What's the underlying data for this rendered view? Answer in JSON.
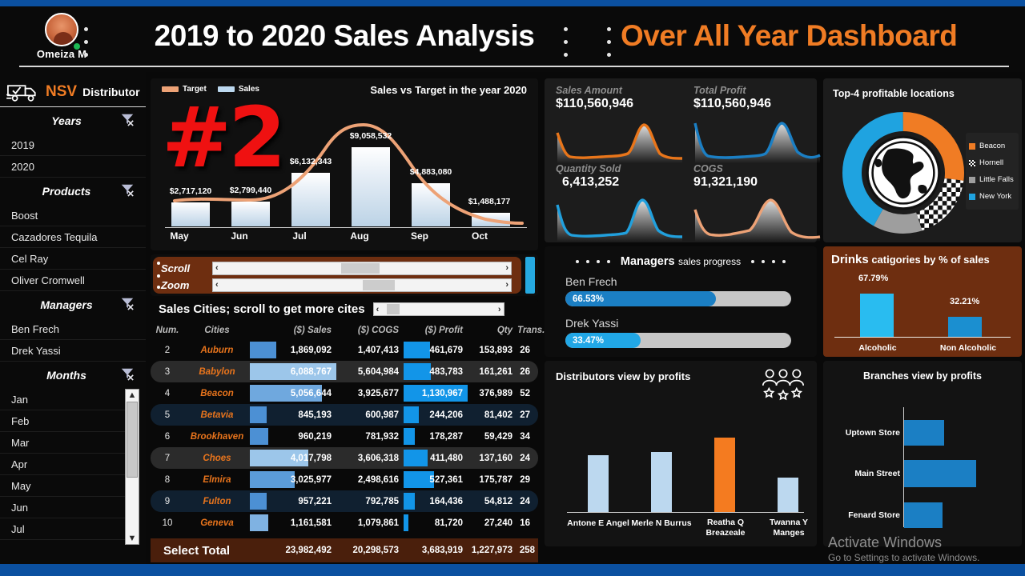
{
  "header": {
    "user_name": "Omeiza M",
    "title": "2019 to 2020 Sales Analysis",
    "subtitle": "Over All Year Dashboard"
  },
  "sidebar": {
    "brand_primary": "NSV",
    "brand_secondary": "Distributor",
    "sections": [
      {
        "label": "Years",
        "items": [
          "2019",
          "2020"
        ]
      },
      {
        "label": "Products",
        "items": [
          "Boost",
          "Cazadores Tequila",
          "Cel Ray",
          "Oliver Cromwell"
        ]
      },
      {
        "label": "Managers",
        "items": [
          "Ben Frech",
          "Drek Yassi"
        ]
      },
      {
        "label": "Months",
        "items": [
          "Jan",
          "Feb",
          "Mar",
          "Apr",
          "May",
          "Jun",
          "Jul"
        ]
      }
    ]
  },
  "sales_vs_target": {
    "legend": [
      {
        "label": "Target",
        "color": "#eda276"
      },
      {
        "label": "Sales",
        "color": "#bcd8ef"
      }
    ],
    "title": "Sales vs Target in the year 2020",
    "rank_badge": "#2",
    "chart_data": {
      "type": "bar",
      "title": "Sales vs Target in the year 2020",
      "xlabel": "",
      "ylabel": "",
      "categories": [
        "May",
        "Jun",
        "Jul",
        "Aug",
        "Sep",
        "Oct"
      ],
      "series": [
        {
          "name": "Sales",
          "values": [
            2717120,
            2799440,
            6132343,
            9058532,
            4883080,
            1488177
          ],
          "labels": [
            "$2,717,120",
            "$2,799,440",
            "$6,132,343",
            "$9,058,532",
            "$4,883,080",
            "$1,488,177"
          ]
        },
        {
          "name": "Target",
          "values": [
            1650000,
            1500000,
            5500000,
            9600000,
            4500000,
            900000
          ]
        }
      ],
      "ylim": [
        0,
        10000000
      ],
      "grid": false,
      "legend_position": "top-left"
    }
  },
  "kpi": {
    "cards": [
      {
        "title": "Sales Amount",
        "value": "$110,560,946",
        "color": "#e8751a"
      },
      {
        "title": "Total Profit",
        "value": "$110,560,946",
        "color": "#1b7fc4"
      },
      {
        "title": "Quantity Sold",
        "value": "6,413,252",
        "color": "#21a0dd"
      },
      {
        "title": "COGS",
        "value": "91,321,190",
        "color": "#eda276"
      }
    ]
  },
  "locations": {
    "title": "Top-4 profitable locations",
    "chart_data": {
      "type": "pie",
      "title": "Top-4 profitable locations",
      "categories": [
        "Beacon",
        "Hornell",
        "Little Falls",
        "New York"
      ],
      "values": [
        27,
        18,
        13,
        42
      ],
      "colors": [
        "#f07c24",
        "#ffffff",
        "#9e9e9e",
        "#1fa3e0"
      ],
      "legend_position": "right"
    },
    "legend": [
      {
        "label": "Beacon",
        "color": "#f07c24"
      },
      {
        "label": "Hornell",
        "color": "#ffffff"
      },
      {
        "label": "Little Falls",
        "color": "#9e9e9e"
      },
      {
        "label": "New York",
        "color": "#1fa3e0"
      }
    ]
  },
  "controls": {
    "scroll_label": "Scroll",
    "zoom_label": "Zoom",
    "arrow_left": "‹",
    "arrow_right": "›"
  },
  "cities": {
    "title": "Sales Cities; scroll to get more cites",
    "columns": [
      "Num.",
      "Cities",
      "($) Sales",
      "($) COGS",
      "($) Profit",
      "Qty",
      "Trans."
    ],
    "rows": [
      {
        "num": "2",
        "city": "Auburn",
        "sales": "1,869,092",
        "cogs": "1,407,413",
        "profit": "461,679",
        "qty": "153,893",
        "dot": "#e8563f",
        "trans": "26",
        "sales_pct": 31,
        "profit_pct": 41
      },
      {
        "num": "3",
        "city": "Babylon",
        "sales": "6,088,767",
        "cogs": "5,604,984",
        "profit": "483,783",
        "qty": "161,261",
        "dot": "#e8684a",
        "trans": "26",
        "sales_pct": 100,
        "profit_pct": 43
      },
      {
        "num": "4",
        "city": "Beacon",
        "sales": "5,056,644",
        "cogs": "3,925,677",
        "profit": "1,130,967",
        "qty": "376,989",
        "dot": "#4fc3a1",
        "trans": "52",
        "sales_pct": 83,
        "profit_pct": 100
      },
      {
        "num": "5",
        "city": "Betavia",
        "sales": "845,193",
        "cogs": "600,987",
        "profit": "244,206",
        "qty": "81,402",
        "dot": "#e8563f",
        "trans": "27",
        "sales_pct": 14,
        "profit_pct": 22
      },
      {
        "num": "6",
        "city": "Brookhaven",
        "sales": "960,219",
        "cogs": "781,932",
        "profit": "178,287",
        "qty": "59,429",
        "dot": "#f2d6ac",
        "trans": "34",
        "sales_pct": 16,
        "profit_pct": 16
      },
      {
        "num": "7",
        "city": "Choes",
        "sales": "4,017,798",
        "cogs": "3,606,318",
        "profit": "411,480",
        "qty": "137,160",
        "dot": "#e8563f",
        "trans": "24",
        "sales_pct": 66,
        "profit_pct": 36
      },
      {
        "num": "8",
        "city": "Elmira",
        "sales": "3,025,977",
        "cogs": "2,498,616",
        "profit": "527,361",
        "qty": "175,787",
        "dot": "#f2d6ac",
        "trans": "29",
        "sales_pct": 50,
        "profit_pct": 47
      },
      {
        "num": "9",
        "city": "Fulton",
        "sales": "957,221",
        "cogs": "792,785",
        "profit": "164,436",
        "qty": "54,812",
        "dot": "#e8563f",
        "trans": "24",
        "sales_pct": 16,
        "profit_pct": 15
      },
      {
        "num": "10",
        "city": "Geneva",
        "sales": "1,161,581",
        "cogs": "1,079,861",
        "profit": "81,720",
        "qty": "27,240",
        "dot": "#e8563f",
        "trans": "16",
        "sales_pct": 19,
        "profit_pct": 7
      }
    ],
    "total": {
      "label": "Select Total",
      "sales": "23,982,492",
      "cogs": "20,298,573",
      "profit": "3,683,919",
      "qty": "1,227,973",
      "trans": "258"
    }
  },
  "managers": {
    "title_bold": "Managers",
    "title_rest": "sales progress",
    "chart_data": {
      "type": "bar",
      "title": "Managers sales progress",
      "categories": [
        "Ben Frech",
        "Drek Yassi"
      ],
      "values": [
        66.53,
        33.47
      ],
      "labels": [
        "66.53%",
        "33.47%"
      ],
      "ylim": [
        0,
        100
      ]
    },
    "rows": [
      {
        "name": "Ben Frech",
        "pct_label": "66.53%",
        "pct": 66.53,
        "color": "#1b7fc4"
      },
      {
        "name": "Drek Yassi",
        "pct_label": "33.47%",
        "pct": 33.47,
        "color": "#21a7e6"
      }
    ]
  },
  "drinks": {
    "title_bold": "Drinks",
    "title_rest": "catigories by % of sales",
    "chart_data": {
      "type": "bar",
      "title": "Drinks catigories by % of sales",
      "categories": [
        "Alcoholic",
        "Non Alcoholic"
      ],
      "values": [
        67.79,
        32.21
      ],
      "labels": [
        "67.79%",
        "32.21%"
      ],
      "colors": [
        "#29bcf0",
        "#1b8fd0"
      ],
      "ylim": [
        0,
        100
      ],
      "grid": false
    }
  },
  "distributors": {
    "title": "Distributors view by profits",
    "chart_data": {
      "type": "bar",
      "title": "Distributors view by profits",
      "categories": [
        "Antone E Angel",
        "Merle N Burrus",
        "Reatha Q Breazeale",
        "Twanna Y Manges"
      ],
      "values": [
        70,
        74,
        88,
        46
      ],
      "colors": [
        "#bcd8ef",
        "#bcd8ef",
        "#f47b20",
        "#bcd8ef"
      ],
      "ylim": [
        0,
        100
      ],
      "grid": false
    }
  },
  "branches": {
    "title": "Branches view by profits",
    "chart_data": {
      "type": "bar",
      "title": "Branches view by profits",
      "categories": [
        "Uptown Store",
        "Main Street",
        "Fenard Store"
      ],
      "values": [
        47,
        85,
        45
      ],
      "colors": [
        "#1b7fc4",
        "#1b7fc4",
        "#1b7fc4"
      ],
      "xlim": [
        0,
        100
      ],
      "grid": false,
      "orientation": "horizontal"
    }
  },
  "watermark": {
    "line1": "Activate Windows",
    "line2": "Go to Settings to activate Windows."
  }
}
